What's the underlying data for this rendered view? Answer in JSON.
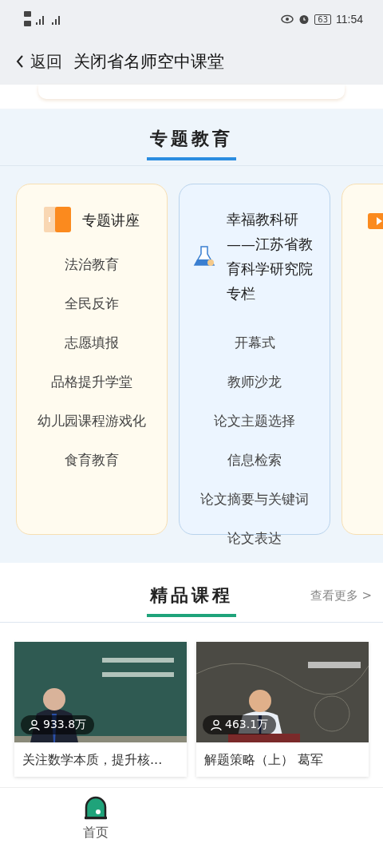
{
  "status_bar": {
    "time": "11:54",
    "battery": "63"
  },
  "header": {
    "back_label": "返回",
    "title": "关闭省名师空中课堂"
  },
  "topics": {
    "title": "专题教育",
    "cards": [
      {
        "kind": "lecture",
        "title": "专题讲座",
        "items": [
          "法治教育",
          "全民反诈",
          "志愿填报",
          "品格提升学堂",
          "幼儿园课程游戏化",
          "食育教育"
        ]
      },
      {
        "kind": "research",
        "title": "幸福教科研——江苏省教育科学研究院专栏",
        "items": [
          "开幕式",
          "教师沙龙",
          "论文主题选择",
          "信息检索",
          "论文摘要与关键词",
          "论文表达"
        ]
      },
      {
        "kind": "video"
      }
    ]
  },
  "courses": {
    "title": "精品课程",
    "more": "查看更多 >",
    "items": [
      {
        "views": "933.8万",
        "title": "关注数学本质，提升核..."
      },
      {
        "views": "463.1万",
        "title": "解题策略（上） 葛军"
      }
    ]
  },
  "bottom_nav": [
    {
      "label": "首页",
      "selected": true
    }
  ]
}
